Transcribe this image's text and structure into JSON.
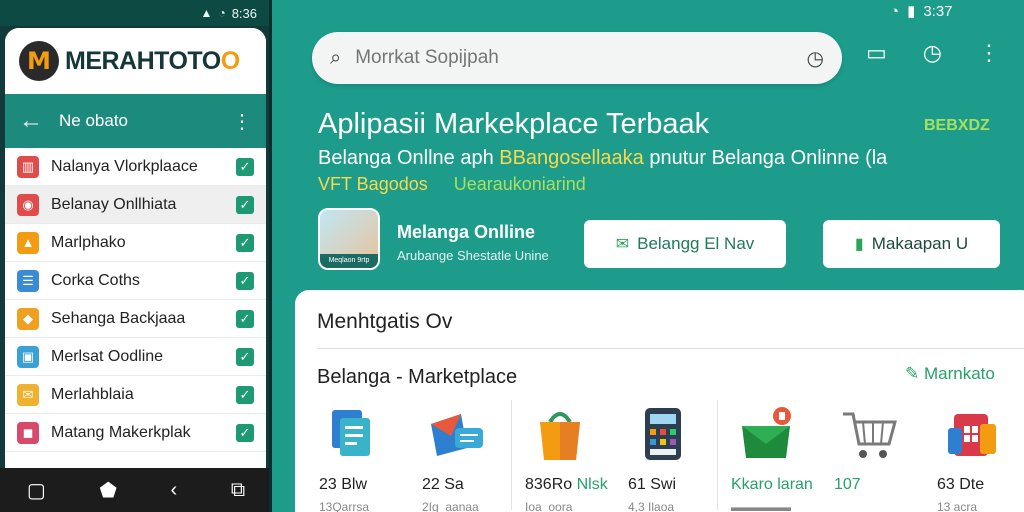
{
  "phone": {
    "status_time": "8:36",
    "brand_prefix": "MERAHTOTO",
    "brand_accent": "O",
    "nav_title": "Ne obato",
    "items": [
      {
        "label": "Nalanya Vlorkplaace",
        "icon": "store-icon",
        "color": "#e04b4b",
        "glyph": "▥",
        "selected": false
      },
      {
        "label": "Belanay Onllhiata",
        "icon": "bag-icon",
        "color": "#e04b4b",
        "glyph": "◉",
        "selected": true
      },
      {
        "label": "Marlphako",
        "icon": "shopping-bag-icon",
        "color": "#f39c12",
        "glyph": "▲",
        "selected": false
      },
      {
        "label": "Corka Coths",
        "icon": "receipt-icon",
        "color": "#3a8ad6",
        "glyph": "☰",
        "selected": false
      },
      {
        "label": "Sehanga Backjaaa",
        "icon": "tag-icon",
        "color": "#f0a020",
        "glyph": "◆",
        "selected": false
      },
      {
        "label": "Merlsat Oodline",
        "icon": "package-icon",
        "color": "#3aa0d6",
        "glyph": "▣",
        "selected": false
      },
      {
        "label": "Merlahblaia",
        "icon": "cart-icon",
        "color": "#f0b030",
        "glyph": "✉",
        "selected": false
      },
      {
        "label": "Matang Makerkplak",
        "icon": "basket-icon",
        "color": "#d84a6a",
        "glyph": "◼",
        "selected": false
      }
    ]
  },
  "app": {
    "status_time": "3:37",
    "search_placeholder": "Morrkat Sopijpah",
    "headline": "Aplipasii Markekplace Terbaak",
    "badge": "BEBXDZ",
    "subline_a": "Belanga  Onllne  aph ",
    "subline_hl": "BBangosellaaka",
    "subline_b": "  pnutur Belanga Onlinne  (la",
    "subline2_y": "VFT      Bagodos",
    "subline2_g": "Uearaukoniarind",
    "app_name": "Melanga Onlline",
    "app_sub": "Arubange Shestatle Unine",
    "tile_caption": "Meqlaon 9rtp",
    "btn1": "Belangg  El Nav",
    "btn2": "Makaapan  U",
    "panel_title": "Menhtgatis Ov",
    "section_title": "Belanga - Marketplace",
    "section_link": "Marnkato",
    "cards": [
      {
        "icon": "document-edit-icon",
        "value": "23 Blw",
        "sub": "13Qarrsa"
      },
      {
        "icon": "mail-chat-icon",
        "value": "22 Sa",
        "sub": "2Ig_aanaa"
      },
      {
        "icon": "shopping-bag-icon",
        "value": "836Ro",
        "value_green": "Nlsk",
        "sub": "Ioa_oora"
      },
      {
        "icon": "calculator-icon",
        "value": "61 Swi",
        "sub": "4,3 Ilaoa"
      },
      {
        "icon": "envelope-icon",
        "value": "",
        "value_green": "Kkaro laran",
        "sub": "▬▬▬▬▬"
      },
      {
        "icon": "cart-icon",
        "value": "",
        "value_green": "107",
        "sub": ""
      },
      {
        "icon": "store-box-icon",
        "value": "63 Dte",
        "sub": "13 acra"
      }
    ]
  },
  "colors": {
    "teal_bg": "#1d9c8c",
    "nav_teal": "#1d8a7e",
    "accent_orange": "#f39c12",
    "accent_green": "#27a06b",
    "highlight_yellow": "#f7d94c"
  }
}
